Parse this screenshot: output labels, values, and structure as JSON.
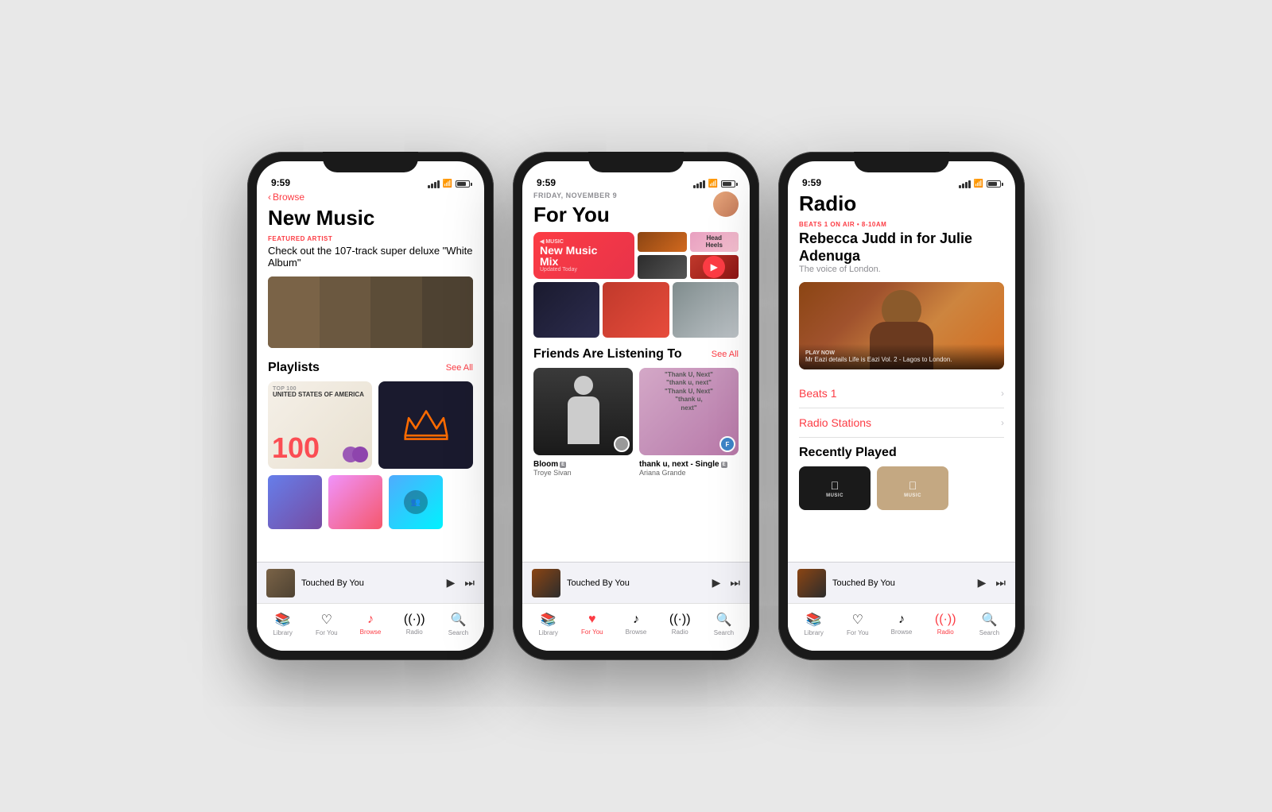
{
  "phones": [
    {
      "id": "browse",
      "statusBar": {
        "time": "9:59",
        "icons": "signal wifi battery"
      },
      "screen": "browse",
      "backLink": "Browse",
      "pageTitle": "New Music",
      "featuredLabel": "FEATURED ARTIST",
      "featuredText": "Check out the 107-track super deluxe \"White Album\"",
      "sectionPlaylists": "Playlists",
      "seeAll1": "See All",
      "top100Label": "TOP 100",
      "top100Country": "UNITED STATES OF AMERICA",
      "miniPlayer": {
        "title": "Touched By You",
        "controls": [
          "▶",
          "⏭"
        ]
      },
      "navItems": [
        {
          "label": "Library",
          "icon": "📚",
          "active": false
        },
        {
          "label": "For You",
          "icon": "♥",
          "active": false
        },
        {
          "label": "Browse",
          "icon": "♪",
          "active": true
        },
        {
          "label": "Radio",
          "icon": "📻",
          "active": false
        },
        {
          "label": "Search",
          "icon": "🔍",
          "active": false
        }
      ]
    },
    {
      "id": "foryou",
      "statusBar": {
        "time": "9:59"
      },
      "screen": "foryou",
      "dateLabel": "FRIDAY, NOVEMBER 9",
      "pageTitle": "For You",
      "newMusicMix": "New Music Mix",
      "updatedToday": "Updated Today",
      "friendsSection": "Friends Are Listening To",
      "seeAll": "See All",
      "bloomAlbum": "Bloom",
      "bloomArtist": "Troye Sivan",
      "arianaAlbum": "thank u, next - Single",
      "arianaArtist": "Ariana Grande",
      "miniPlayer": {
        "title": "Touched By You"
      },
      "navItems": [
        {
          "label": "Library",
          "active": false
        },
        {
          "label": "For You",
          "active": true
        },
        {
          "label": "Browse",
          "active": false
        },
        {
          "label": "Radio",
          "active": false
        },
        {
          "label": "Search",
          "active": false
        }
      ]
    },
    {
      "id": "radio",
      "statusBar": {
        "time": "9:59"
      },
      "screen": "radio",
      "pageTitle": "Radio",
      "beatsLabel": "BEATS 1 ON AIR • 8-10AM",
      "radioHost": "Rebecca Judd in for Julie Adenuga",
      "radioSub": "The voice of London.",
      "playNow": "PLAY NOW",
      "radioDesc": "Mr Eazi details Life is Eazi Vol. 2 - Lagos to London.",
      "beats1": "Beats 1",
      "radioStations": "Radio Stations",
      "recentlyPlayed": "Recently Played",
      "miniPlayer": {
        "title": "Touched By You"
      },
      "navItems": [
        {
          "label": "Library",
          "active": false
        },
        {
          "label": "For You",
          "active": false
        },
        {
          "label": "Browse",
          "active": false
        },
        {
          "label": "Radio",
          "active": true
        },
        {
          "label": "Search",
          "active": false
        }
      ]
    }
  ]
}
